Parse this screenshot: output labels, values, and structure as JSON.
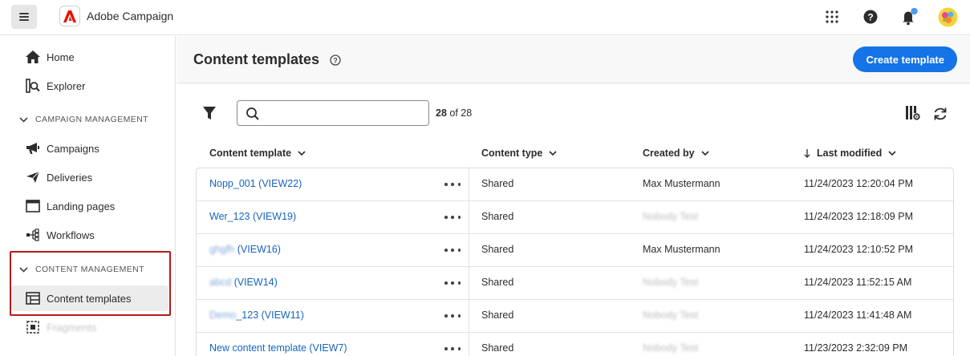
{
  "app": {
    "title": "Adobe Campaign"
  },
  "topbar": {
    "icons": [
      "menu-icon",
      "adobe-logo-icon",
      "apps-grid-icon",
      "help-icon",
      "notifications-icon",
      "avatar"
    ],
    "notification_color": "#4b9cf5"
  },
  "sidebar": {
    "items_top": [
      {
        "label": "Home",
        "icon": "home-icon"
      },
      {
        "label": "Explorer",
        "icon": "explorer-icon"
      }
    ],
    "sections": [
      {
        "header": "CAMPAIGN MANAGEMENT",
        "items": [
          {
            "label": "Campaigns",
            "icon": "megaphone-icon"
          },
          {
            "label": "Deliveries",
            "icon": "send-icon"
          },
          {
            "label": "Landing pages",
            "icon": "browser-icon"
          },
          {
            "label": "Workflows",
            "icon": "workflow-icon"
          }
        ]
      },
      {
        "header": "CONTENT MANAGEMENT",
        "items": [
          {
            "label": "Content templates",
            "icon": "template-icon",
            "active": true
          },
          {
            "label": "Fragments",
            "icon": "fragment-icon",
            "blurred": true
          }
        ]
      }
    ]
  },
  "page": {
    "title": "Content templates",
    "create_button": "Create template",
    "search_placeholder": "",
    "count_current": "28",
    "count_total": "of 28"
  },
  "table": {
    "columns": [
      "Content template",
      "Content type",
      "Created by",
      "Last modified"
    ],
    "sorted_column": "Last modified",
    "rows": [
      {
        "name_prefix": "",
        "name": "Nopp_001 (VIEW22)",
        "type": "Shared",
        "created_by": "Max Mustermann",
        "created_blurred": false,
        "modified": "11/24/2023 12:20:04 PM"
      },
      {
        "name_prefix": "",
        "name": "Wer_123 (VIEW19)",
        "type": "Shared",
        "created_by": "Nobody Test",
        "created_blurred": true,
        "modified": "11/24/2023 12:18:09 PM"
      },
      {
        "name_prefix": "ghgfh",
        "name": " (VIEW16)",
        "type": "Shared",
        "created_by": "Max Mustermann",
        "created_blurred": false,
        "modified": "11/24/2023 12:10:52 PM"
      },
      {
        "name_prefix": "abcd",
        "name": " (VIEW14)",
        "type": "Shared",
        "created_by": "Nobody Test",
        "created_blurred": true,
        "modified": "11/24/2023 11:52:15 AM"
      },
      {
        "name_prefix": "Demo",
        "name": "_123 (VIEW11)",
        "type": "Shared",
        "created_by": "Nobody Test",
        "created_blurred": true,
        "modified": "11/24/2023 11:41:48 AM"
      },
      {
        "name_prefix": "",
        "name": "New content template (VIEW7)",
        "type": "Shared",
        "created_by": "Nobody Test",
        "created_blurred": true,
        "modified": "11/23/2023 2:32:09 PM"
      }
    ]
  },
  "colors": {
    "accent": "#1473e6",
    "link": "#1565c0",
    "highlight_border": "#b31b1b"
  }
}
